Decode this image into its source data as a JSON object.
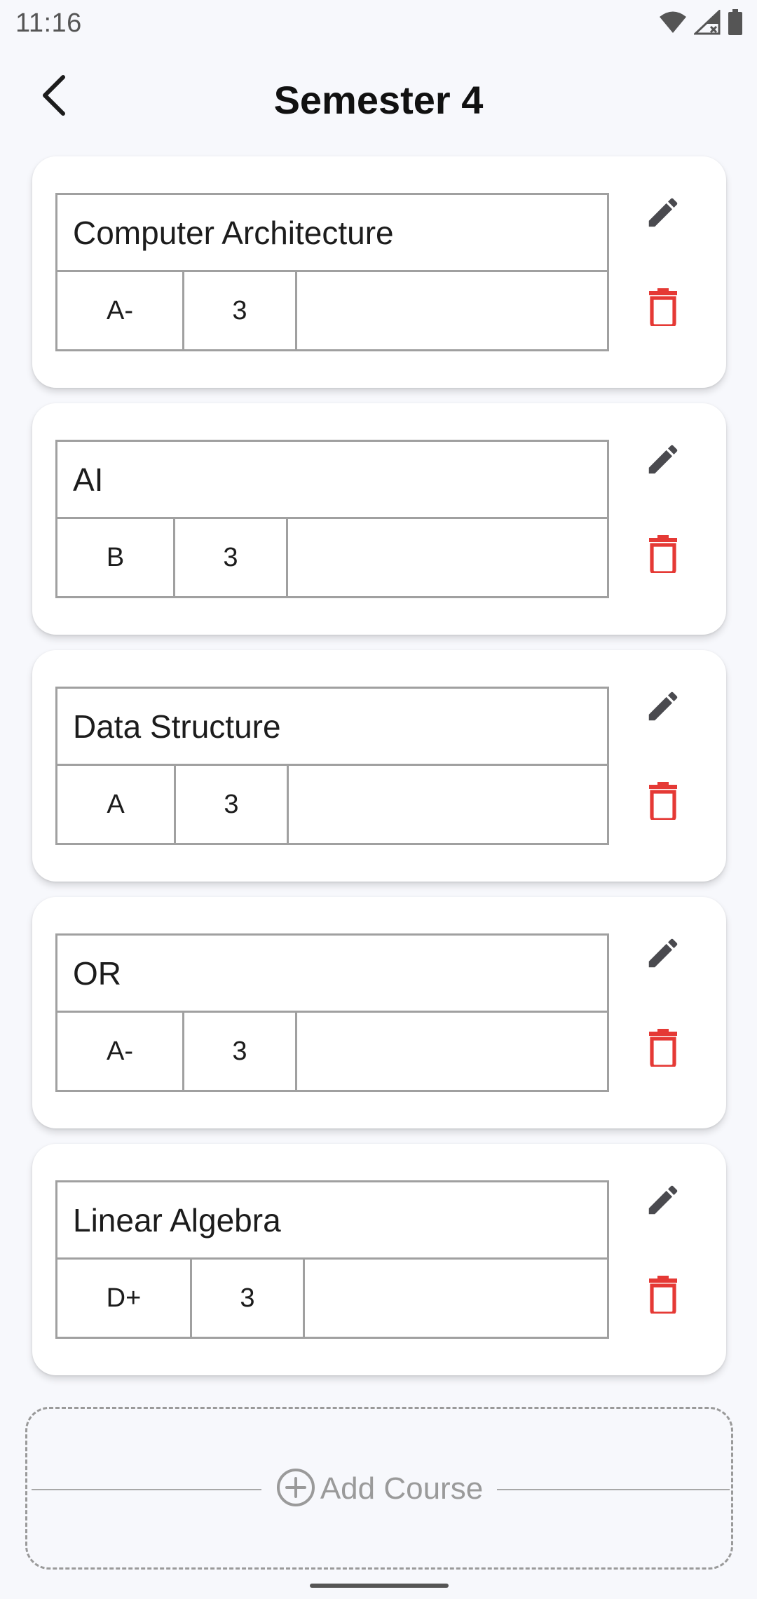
{
  "status": {
    "time": "11:16",
    "icons": [
      "wifi-icon",
      "cellular-signal-icon",
      "battery-icon"
    ]
  },
  "header": {
    "title": "Semester 4",
    "back_icon": "chevron-left-icon"
  },
  "courses": [
    {
      "name": "Computer Architecture",
      "grade": "A-",
      "credits": "3",
      "note": ""
    },
    {
      "name": "AI",
      "grade": "B",
      "credits": "3",
      "note": ""
    },
    {
      "name": "Data Structure",
      "grade": "A",
      "credits": "3",
      "note": ""
    },
    {
      "name": "OR",
      "grade": "A-",
      "credits": "3",
      "note": ""
    },
    {
      "name": "Linear Algebra",
      "grade": "D+",
      "credits": "3",
      "note": ""
    }
  ],
  "actions": {
    "edit_icon": "pencil-icon",
    "delete_icon": "trash-icon",
    "delete_color": "#e53935",
    "edit_color": "#4a4a4f"
  },
  "add_course": {
    "label": "Add Course",
    "icon": "plus-circle-icon"
  }
}
